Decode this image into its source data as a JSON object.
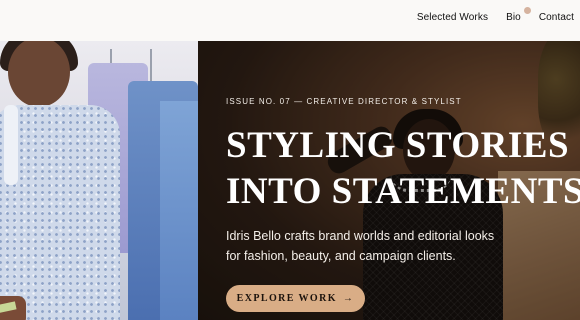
{
  "nav": {
    "items": [
      {
        "label": "Selected Works"
      },
      {
        "label": "Bio"
      },
      {
        "label": "Contact"
      }
    ],
    "bio_dot_color": "#d5b39f"
  },
  "hero": {
    "eyebrow": "ISSUE NO. 07 — CREATIVE DIRECTOR & STYLIST",
    "headline_line1": "STYLING STORIES",
    "headline_line2": "INTO STATEMENTS",
    "description": "Idris Bello crafts brand worlds and editorial looks for fashion, beauty, and campaign clients.",
    "cta_label": "EXPLORE WORK",
    "cta_icon": "arrow-right-icon",
    "cta_arrow": "→",
    "accent_color": "#d9ad86"
  }
}
